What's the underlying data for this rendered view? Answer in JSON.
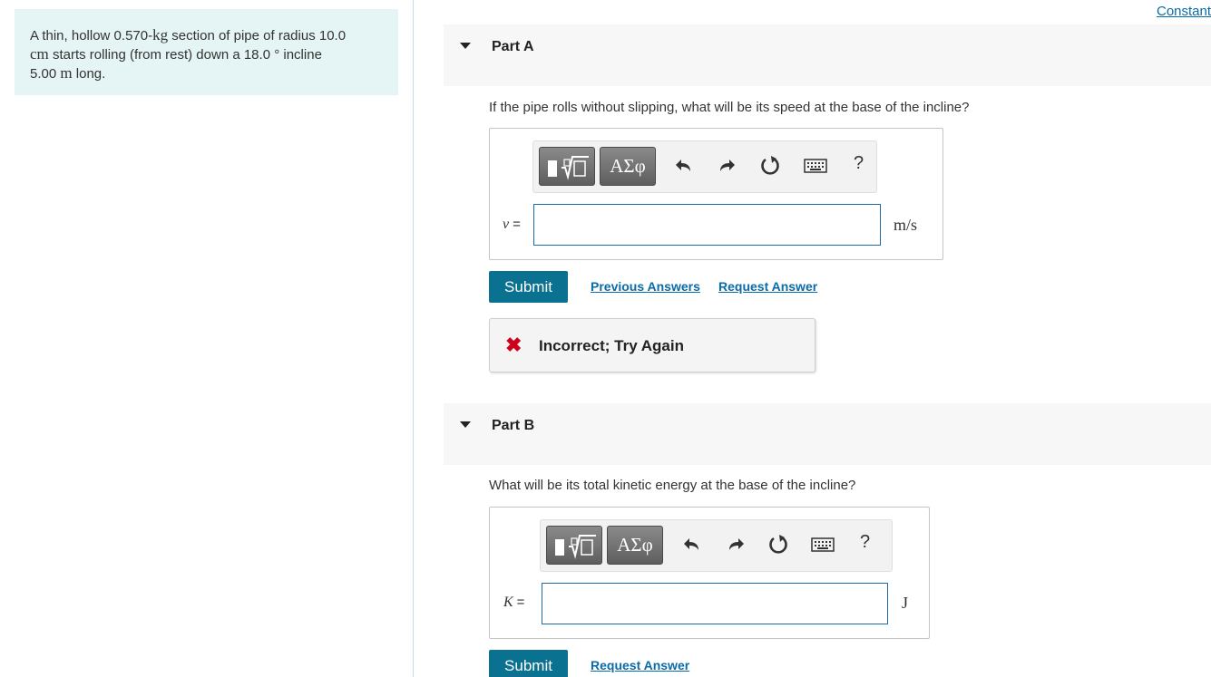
{
  "problem": {
    "t1": "A thin, hollow 0.570-",
    "u1": "kg",
    "t2": " section of pipe of radius 10.0",
    "u2": "cm",
    "t3": " starts rolling (from rest) down a 18.0 ",
    "deg": "°",
    "t4": " incline",
    "t5": "5.00 ",
    "u3": "m",
    "t6": " long."
  },
  "constants_link": "Constants",
  "parts": [
    {
      "label": "Part A",
      "question": "If the pipe rolls without slipping, what will be its speed at the base of the incline?",
      "variable": "v",
      "equals": "=",
      "input_value": "",
      "unit": "m/s",
      "submit_label": "Submit",
      "links": [
        "Previous Answers",
        "Request Answer"
      ],
      "feedback": {
        "icon": "✖",
        "message": "Incorrect; Try Again"
      }
    },
    {
      "label": "Part B",
      "question": "What will be its total kinetic energy at the base of the incline?",
      "variable": "K",
      "equals": "=",
      "input_value": "",
      "unit": "J",
      "submit_label": "Submit",
      "links": [
        "Request Answer"
      ]
    }
  ],
  "toolbar": {
    "symbols_label": "ΑΣφ",
    "undo_glyph": "↶",
    "redo_glyph": "↷",
    "reset_glyph": "↻",
    "help_label": "?",
    "icons": [
      "templates-icon",
      "undo-icon",
      "redo-icon",
      "reset-icon",
      "keyboard-icon",
      "help-icon"
    ]
  },
  "colors": {
    "problem_bg": "#e5f4f4",
    "submit_bg": "#0a7190",
    "link": "#0a6ba8",
    "error": "#d0021b",
    "input_border": "#1d6aa8"
  }
}
